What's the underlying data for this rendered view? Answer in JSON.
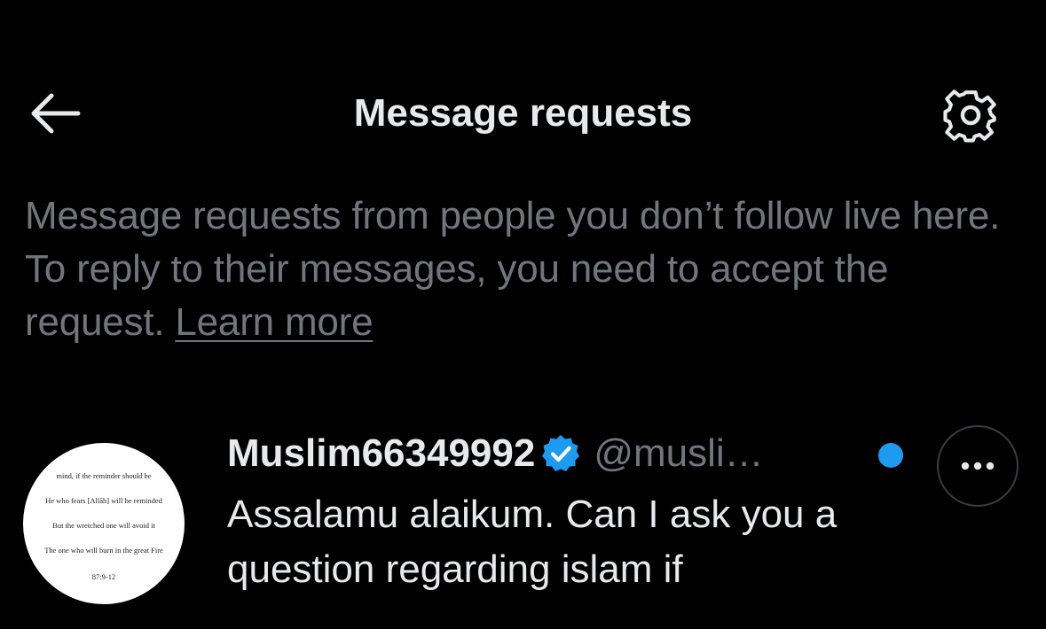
{
  "header": {
    "title": "Message requests",
    "back_icon": "arrow-left-icon",
    "settings_icon": "gear-icon"
  },
  "intro": {
    "text": "Message requests from people you don’t follow live here. To reply to their messages, you need to accept the request.",
    "learn_more": "Learn more"
  },
  "requests": [
    {
      "display_name": "Muslim66349992",
      "verified": true,
      "handle": "@musli…",
      "unread": true,
      "preview": "Assalamu alaikum.  Can I ask you a question regarding islam if",
      "avatar_lines": [
        "mind, if the reminder should be",
        "He who fears [Allāh] will be reminded",
        "But the wretched one will avoid it",
        "The one who will burn in the great Fire",
        "87:9-12"
      ]
    }
  ],
  "colors": {
    "background": "#000000",
    "text_primary": "#e7e9ea",
    "text_secondary": "#71767b",
    "accent": "#1d9bf0"
  }
}
